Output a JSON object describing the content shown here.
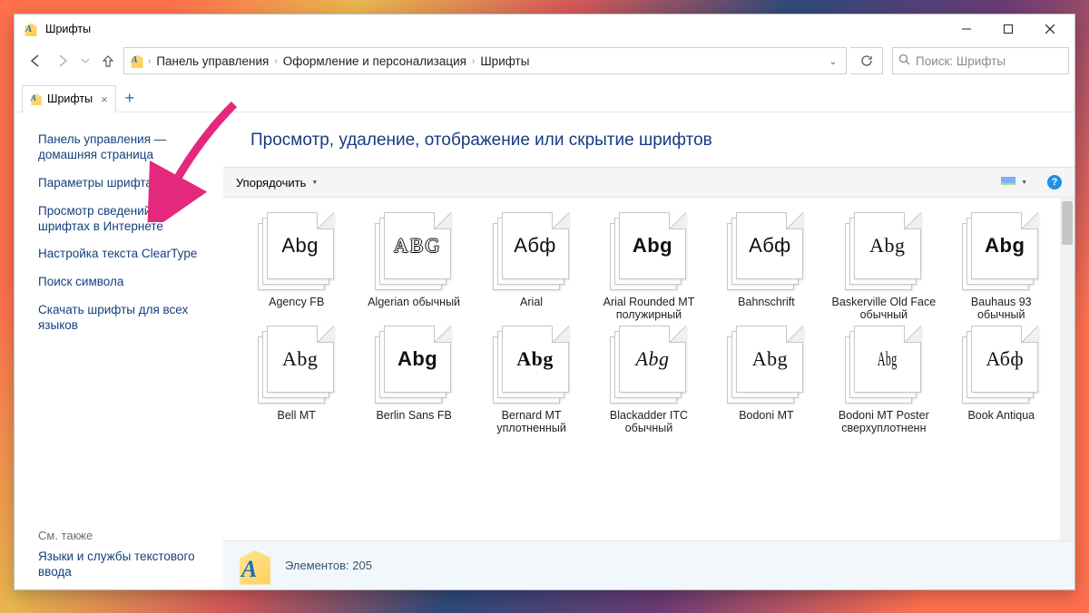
{
  "titlebar": {
    "title": "Шрифты"
  },
  "address": {
    "crumbs": [
      "Панель управления",
      "Оформление и персонализация",
      "Шрифты"
    ]
  },
  "search": {
    "placeholder": "Поиск: Шрифты"
  },
  "tab": {
    "label": "Шрифты"
  },
  "sidebar": {
    "links": [
      "Панель управления — домашняя страница",
      "Параметры шрифта",
      "Просмотр сведений о шрифтах в Интернете",
      "Настройка текста ClearType",
      "Поиск символа",
      "Скачать шрифты для всех языков"
    ],
    "see_also_heading": "См. также",
    "see_also_link": "Языки и службы текстового ввода"
  },
  "main": {
    "heading": "Просмотр, удаление, отображение или скрытие шрифтов",
    "toolbar": {
      "organize": "Упорядочить"
    }
  },
  "fonts": [
    {
      "name": "Agency FB",
      "sample": "Abg",
      "style": "font-family:'Agency FB',sans-serif;font-stretch:condensed;"
    },
    {
      "name": "Algerian обычный",
      "sample": "ABG",
      "style": "font-family:serif;font-variant:small-caps;letter-spacing:2px;text-shadow:1px 0 #000,-1px 0 #000,0 1px #000,0 -1px #000;color:#fff;"
    },
    {
      "name": "Arial",
      "sample": "Абф",
      "style": "font-family:Arial,sans-serif;"
    },
    {
      "name": "Arial Rounded MT полужирный",
      "sample": "Abg",
      "style": "font-family:'Arial Rounded MT Bold',Arial,sans-serif;font-weight:bold;"
    },
    {
      "name": "Bahnschrift",
      "sample": "Абф",
      "style": "font-family:Bahnschrift,sans-serif;"
    },
    {
      "name": "Baskerville Old Face обычный",
      "sample": "Abg",
      "style": "font-family:'Baskerville Old Face',Georgia,serif;"
    },
    {
      "name": "Bauhaus 93 обычный",
      "sample": "Abg",
      "style": "font-family:'Bauhaus 93',sans-serif;font-weight:900;"
    },
    {
      "name": "Bell MT",
      "sample": "Abg",
      "style": "font-family:'Bell MT',Georgia,serif;"
    },
    {
      "name": "Berlin Sans FB",
      "sample": "Abg",
      "style": "font-family:'Berlin Sans FB',sans-serif;font-weight:bold;"
    },
    {
      "name": "Bernard MT уплотненный",
      "sample": "Abg",
      "style": "font-family:'Bernard MT Condensed',serif;font-weight:900;font-stretch:condensed;"
    },
    {
      "name": "Blackadder ITC обычный",
      "sample": "Abg",
      "style": "font-family:'Blackadder ITC',cursive;font-style:italic;"
    },
    {
      "name": "Bodoni MT",
      "sample": "Abg",
      "style": "font-family:'Bodoni MT',Didot,serif;"
    },
    {
      "name": "Bodoni MT Poster сверхуплотненн",
      "sample": "Abg",
      "style": "font-family:'Bodoni MT',Didot,serif;font-stretch:ultra-condensed;transform:scaleX(0.55);"
    },
    {
      "name": "Book Antiqua",
      "sample": "Абф",
      "style": "font-family:'Book Antiqua',Palatino,serif;"
    }
  ],
  "status": {
    "label": "Элементов:",
    "count": "205"
  }
}
